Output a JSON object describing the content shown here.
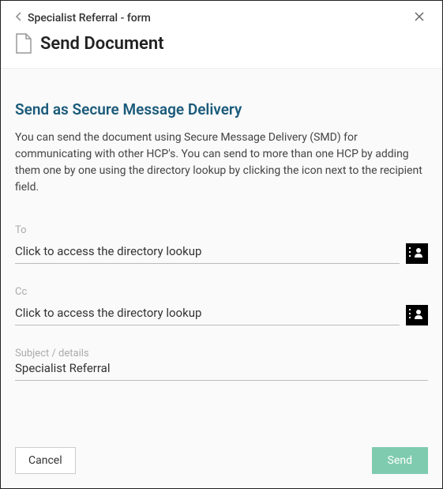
{
  "header": {
    "breadcrumb": "Specialist Referral - form",
    "title": "Send Document"
  },
  "section": {
    "title": "Send as Secure Message Delivery",
    "description": "You can send the document using Secure Message Delivery (SMD) for communicating with other HCP's. You can send to more than one HCP by adding them one by one using the directory lookup by clicking the icon next to the recipient field."
  },
  "fields": {
    "to": {
      "label": "To",
      "placeholder": "Click to access the directory lookup"
    },
    "cc": {
      "label": "Cc",
      "placeholder": "Click to access the directory lookup"
    },
    "subject": {
      "label": "Subject / details",
      "value": "Specialist Referral"
    }
  },
  "buttons": {
    "cancel": "Cancel",
    "send": "Send"
  }
}
